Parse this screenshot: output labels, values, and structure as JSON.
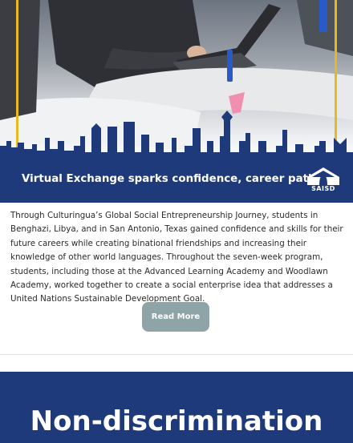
{
  "story": {
    "title": "Virtual Exchange sparks confidence, career paths",
    "body": "Through Culturingua’s Global Social Entrepreneurship Journey, students in Benghazi, Libya, and in San Antonio, Texas gained confidence and skills for their future careers while creating binational friendships and increasing their knowledge of other world languages. Throughout the seven-week program, students, including those at the Advanced Learning Academy and Woodlawn Academy, worked together to create a social enterprise idea that addresses a United Nations Sustainable Development Goal.",
    "read_more_label": "Read More"
  },
  "logo": {
    "text": "SAISD"
  },
  "next_section": {
    "title": "Non-discrimination"
  },
  "colors": {
    "navy": "#1f3a7a",
    "button": "#8fa4a6",
    "accent_yellow": "#e8b820"
  }
}
